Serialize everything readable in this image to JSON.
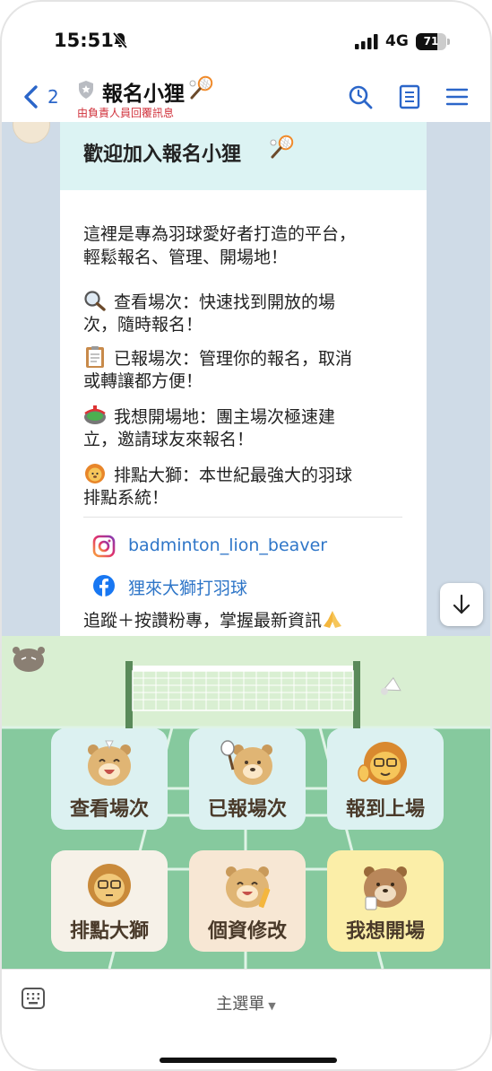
{
  "status_bar": {
    "time": "15:51",
    "network": "4G",
    "battery": "71",
    "battery_level": 0.71
  },
  "header": {
    "back_count": "2",
    "title": "報名小狸",
    "subtitle": "由負責人員回覆訊息",
    "icons": [
      "search-icon",
      "notes-icon",
      "menu-icon"
    ]
  },
  "message": {
    "title": "歡迎加入報名小狸",
    "intro": [
      "這裡是專為羽球愛好者打造的平台，",
      "輕鬆報名、管理、開場地！"
    ],
    "features": [
      {
        "icon": "magnifier-icon",
        "lines": [
          "查看場次：快速找到開放的場",
          "次，隨時報名！"
        ]
      },
      {
        "icon": "clipboard-icon",
        "lines": [
          "已報場次：管理你的報名，取消",
          "或轉讓都方便！"
        ]
      },
      {
        "icon": "stadium-icon",
        "lines": [
          "我想開場地：團主場次極速建",
          "立，邀請球友來報名！"
        ]
      },
      {
        "icon": "lion-icon",
        "lines": [
          "排點大獅：本世紀最強大的羽球",
          "排點系統！"
        ]
      }
    ],
    "instagram": "badminton_lion_beaver",
    "facebook": "狸來大獅打羽球",
    "follow_text": "追蹤＋按讚粉專，掌握最新資訊"
  },
  "rich_menu": {
    "tiles": [
      {
        "label": "查看場次",
        "bg": "#dcf1f1"
      },
      {
        "label": "已報場次",
        "bg": "#dcf1f1"
      },
      {
        "label": "報到上場",
        "bg": "#dcf1f1"
      },
      {
        "label": "排點大獅",
        "bg": "#f6f1e8"
      },
      {
        "label": "個資修改",
        "bg": "#f7e7d4"
      },
      {
        "label": "我想開場",
        "bg": "#fbeea8"
      }
    ]
  },
  "bottom_bar": {
    "menu_label": "主選單"
  },
  "colors": {
    "accent": "#2b66c9",
    "chat_bg": "#cfdbe7",
    "court_green": "#86c99e",
    "link": "#2f76c8",
    "subtitle_red": "#d0313b"
  }
}
